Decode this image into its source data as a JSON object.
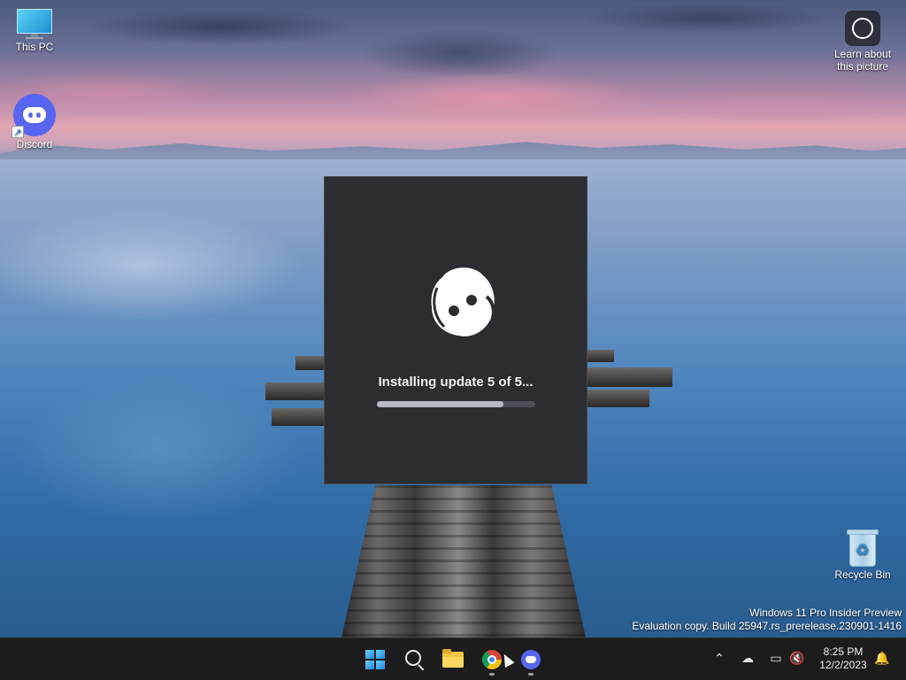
{
  "desktop": {
    "icons": [
      {
        "label": "This PC",
        "icon": "this-pc-icon"
      },
      {
        "label": "Discord",
        "icon": "discord-icon"
      },
      {
        "label": "Learn about this picture",
        "icon": "learn-about-picture-icon"
      },
      {
        "label": "Recycle Bin",
        "icon": "recycle-bin-icon"
      }
    ]
  },
  "updater": {
    "app": "Discord",
    "status": "Installing update 5 of 5...",
    "progress": 0.8
  },
  "watermark": {
    "line1": "Windows 11 Pro Insider Preview",
    "line2": "Evaluation copy. Build 25947.rs_prerelease.230901-1416"
  },
  "taskbar": {
    "apps": [
      {
        "name": "Start",
        "icon": "windows-start-icon",
        "running": false
      },
      {
        "name": "Search",
        "icon": "search-icon",
        "running": false
      },
      {
        "name": "File Explorer",
        "icon": "file-explorer-icon",
        "running": false
      },
      {
        "name": "Google Chrome",
        "icon": "chrome-icon",
        "running": true
      },
      {
        "name": "Discord",
        "icon": "discord-icon",
        "running": true
      }
    ],
    "tray": {
      "icons": [
        "chevron-up-icon",
        "onedrive-offline-icon",
        "network-icon",
        "volume-muted-icon",
        "notification-icon"
      ],
      "time": "8:25 PM",
      "date": "12/2/2023"
    }
  },
  "colors": {
    "discord_blurple": "#5865f2",
    "updater_bg": "#2b2d31",
    "taskbar_bg": "#1c1c1c"
  }
}
